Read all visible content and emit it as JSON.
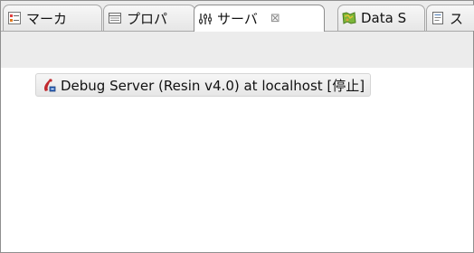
{
  "tabs": [
    {
      "label": "マーカ",
      "icon": "markers-icon"
    },
    {
      "label": "プロパ",
      "icon": "properties-icon"
    },
    {
      "label": "サーバ",
      "icon": "servers-icon",
      "close": "⊠"
    },
    {
      "label": "Data S",
      "icon": "data-source-icon"
    },
    {
      "label": "ス",
      "icon": "snippets-icon"
    }
  ],
  "servers": [
    {
      "label": "Debug Server (Resin v4.0) at localhost  [停止]",
      "icon": "debug-server-icon"
    }
  ],
  "colors": {
    "panel_bg": "#ececec",
    "border": "#a7a7a7",
    "selection_bg": "#e9e9e9"
  }
}
